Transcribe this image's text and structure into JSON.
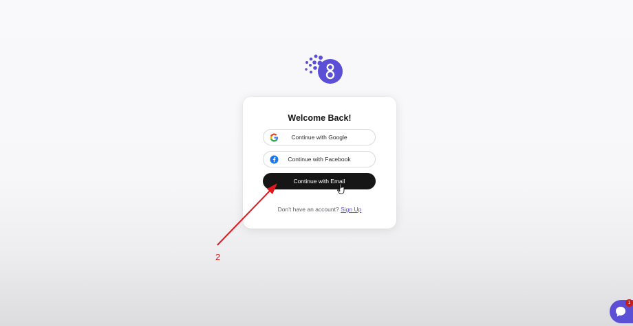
{
  "card": {
    "title": "Welcome Back!",
    "google_label": "Continue with Google",
    "facebook_label": "Continue with Facebook",
    "email_label": "Continue with Email",
    "no_account_text": "Don't have an account?",
    "signup_label": "Sign Up"
  },
  "annotation": {
    "step": "2"
  },
  "chat": {
    "badge_count": "1"
  },
  "icons": {
    "logo": "brand-logo-icon",
    "google": "google-icon",
    "facebook": "facebook-icon",
    "cursor": "hand-cursor-icon",
    "chat": "chat-icon"
  },
  "colors": {
    "brand": "#5b4fd6",
    "dark_button": "#161616",
    "annotation_red": "#e0191e",
    "facebook_blue": "#1877f2"
  }
}
